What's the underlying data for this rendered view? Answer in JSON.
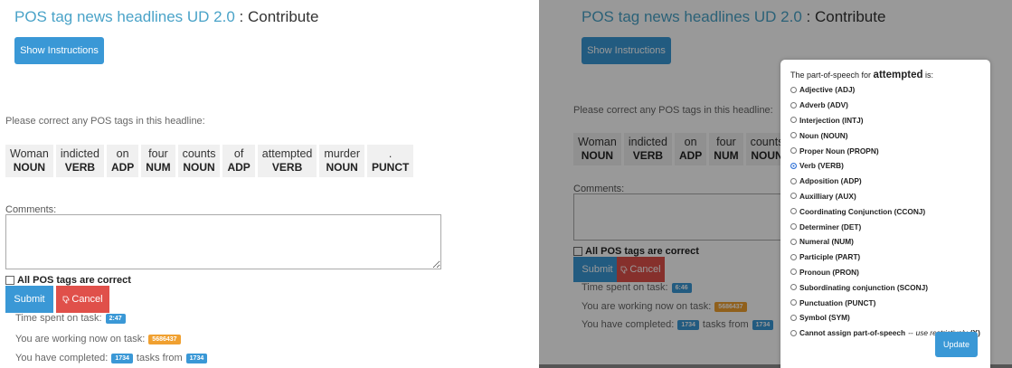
{
  "title": {
    "link": "POS tag news headlines UD 2.0",
    "suffix": " : Contribute"
  },
  "show_instructions_label": "Show Instructions",
  "prompt": "Please correct any POS tags in this headline:",
  "tokens": [
    {
      "word": "Woman",
      "tag": "NOUN"
    },
    {
      "word": "indicted",
      "tag": "VERB"
    },
    {
      "word": "on",
      "tag": "ADP"
    },
    {
      "word": "four",
      "tag": "NUM"
    },
    {
      "word": "counts",
      "tag": "NOUN"
    },
    {
      "word": "of",
      "tag": "ADP"
    },
    {
      "word": "attempted",
      "tag": "VERB"
    },
    {
      "word": "murder",
      "tag": "NOUN"
    },
    {
      "word": ".",
      "tag": "PUNCT"
    }
  ],
  "comments_label": "Comments:",
  "all_correct_label": "All POS tags are correct",
  "submit_label": "Submit",
  "cancel_label": "Cancel",
  "left_stats": {
    "time_label": "Time spent on task:",
    "time_value": "2:47",
    "working_label": "You are working now on task:",
    "working_value": "5686437",
    "completed_label": "You have completed:",
    "completed_value": "1734",
    "tasks_from_label": "tasks from",
    "tasks_from_value": "1734"
  },
  "right_stats": {
    "time_value": "6:46",
    "working_value": "5686437",
    "completed_value": "1734",
    "tasks_from_value": "1734"
  },
  "dialog": {
    "question_prefix": "The part-of-speech for ",
    "word": "attempted",
    "question_suffix": " is:",
    "selected": "Verb (VERB)",
    "options": [
      "Adjective (ADJ)",
      "Adverb (ADV)",
      "Interjection (INTJ)",
      "Noun (NOUN)",
      "Proper Noun (PROPN)",
      "Verb (VERB)",
      "Adposition (ADP)",
      "Auxilliary (AUX)",
      "Coordinating Conjunction (CCONJ)",
      "Determiner (DET)",
      "Numeral (NUM)",
      "Participle (PART)",
      "Pronoun (PRON)",
      "Subordinating conjunction (SCONJ)",
      "Punctuation (PUNCT)",
      "Symbol (SYM)"
    ],
    "last_option": {
      "label": "Cannot assign part-of-speech",
      "dash": " -- ",
      "note": "use restrictively",
      "code": " (X)"
    },
    "update_label": "Update"
  },
  "colors": {
    "primary": "#3a98d6",
    "danger": "#e0504a",
    "warning": "#f0a030",
    "link": "#4aa3c8"
  },
  "icons": {
    "cancel": "thumbs-down-icon"
  }
}
